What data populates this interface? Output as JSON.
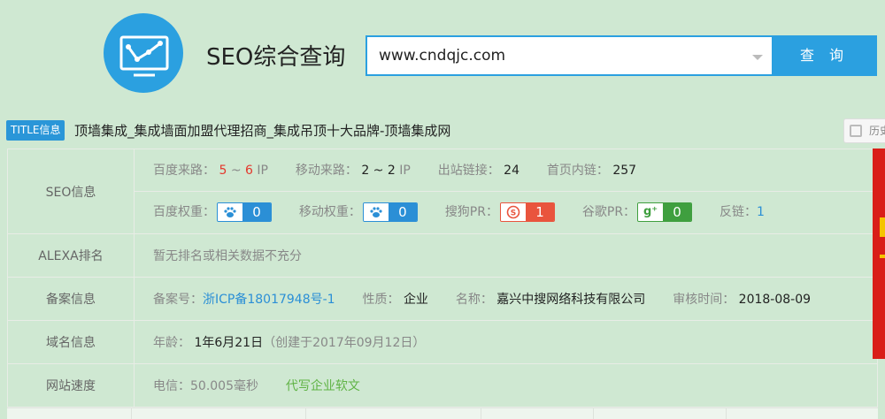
{
  "brand": {
    "title": "SEO综合查询"
  },
  "search": {
    "value": "www.cndqjc.com",
    "button": "查 询"
  },
  "title_info": {
    "tag": "TITLE信息",
    "text": "顶墙集成_集成墙面加盟代理招商_集成吊顶十大品牌-顶墙集成网",
    "history": "历史"
  },
  "seo": {
    "label": "SEO信息",
    "baidu_traffic_label": "百度来路：",
    "baidu_traffic_low": "5",
    "baidu_traffic_sep": " ~ ",
    "baidu_traffic_high": "6",
    "baidu_traffic_unit": "IP",
    "mobile_traffic_label": "移动来路：",
    "mobile_traffic_value": "2 ~ 2",
    "mobile_traffic_unit": "IP",
    "outlinks_label": "出站链接：",
    "outlinks_value": "24",
    "homepage_links_label": "首页内链：",
    "homepage_links_value": "257",
    "baidu_weight_label": "百度权重：",
    "baidu_weight_value": "0",
    "mobile_weight_label": "移动权重：",
    "mobile_weight_value": "0",
    "sogou_pr_label": "搜狗PR：",
    "sogou_pr_value": "1",
    "google_pr_label": "谷歌PR：",
    "google_pr_value": "0",
    "backlinks_label": "反链：",
    "backlinks_value": "1"
  },
  "alexa": {
    "label": "ALEXA排名",
    "text": "暂无排名或相关数据不充分"
  },
  "icp": {
    "label": "备案信息",
    "number_label": "备案号：",
    "number_value": "浙ICP备18017948号-1",
    "nature_label": "性质：",
    "nature_value": "企业",
    "name_label": "名称：",
    "name_value": "嘉兴中搜网络科技有限公司",
    "audit_label": "审核时间：",
    "audit_value": "2018-08-09"
  },
  "domain": {
    "label": "域名信息",
    "age_label": "年龄：",
    "age_value": "1年6月21日",
    "created": "（创建于2017年09月12日）"
  },
  "speed": {
    "label": "网站速度",
    "telecom": "电信：50.005毫秒",
    "ad_link": "代写企业软文"
  },
  "colors": {
    "accent": "#2ba0e0",
    "background": "#cfe8d2",
    "red": "#e4372c",
    "green": "#5fb344"
  }
}
